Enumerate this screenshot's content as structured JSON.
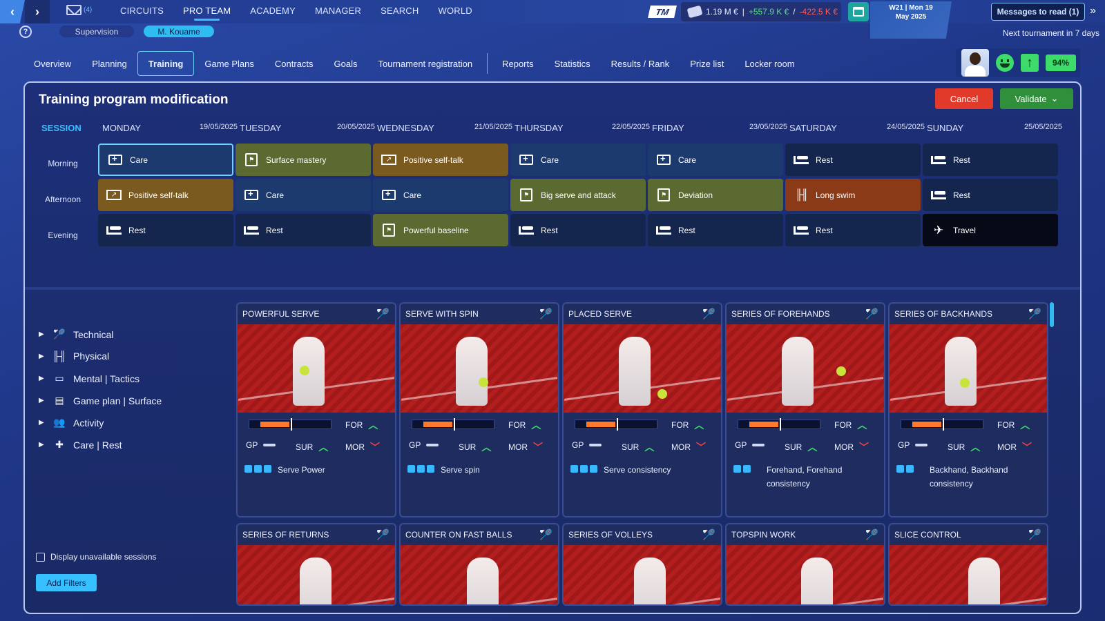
{
  "topbar": {
    "mail_count": "(4)",
    "nav": [
      "CIRCUITS",
      "PRO TEAM",
      "ACADEMY",
      "MANAGER",
      "SEARCH",
      "WORLD"
    ],
    "logo": "TM",
    "balance": "1.19 M €",
    "income": "+557.9 K €",
    "slash": "/",
    "expense": "-422.5 K €",
    "date_line1": "W21 | Mon 19",
    "date_line2": "May 2025",
    "messages": "Messages to read (1)"
  },
  "subheader": {
    "supervision": "Supervision",
    "player": "M. Kouame",
    "next_tournament": "Next tournament in 7 days"
  },
  "subnav": [
    "Overview",
    "Planning",
    "Training",
    "Game Plans",
    "Contracts",
    "Goals",
    "Tournament registration",
    "Reports",
    "Statistics",
    "Results / Rank",
    "Prize list",
    "Locker room"
  ],
  "player_status": {
    "percent": "94%"
  },
  "panel": {
    "title": "Training program modification",
    "cancel": "Cancel",
    "validate": "Validate",
    "session_label": "SESSION",
    "times": [
      "Morning",
      "Afternoon",
      "Evening"
    ],
    "days": [
      {
        "name": "MONDAY",
        "date": "19/05/2025"
      },
      {
        "name": "TUESDAY",
        "date": "20/05/2025"
      },
      {
        "name": "WEDNESDAY",
        "date": "21/05/2025"
      },
      {
        "name": "THURSDAY",
        "date": "22/05/2025"
      },
      {
        "name": "FRIDAY",
        "date": "23/05/2025"
      },
      {
        "name": "SATURDAY",
        "date": "24/05/2025"
      },
      {
        "name": "SUNDAY",
        "date": "25/05/2025"
      }
    ],
    "schedule": [
      [
        {
          "label": "Care",
          "type": "care"
        },
        {
          "label": "Surface mastery",
          "type": "gameplan"
        },
        {
          "label": "Positive self-talk",
          "type": "mental"
        },
        {
          "label": "Care",
          "type": "care"
        },
        {
          "label": "Care",
          "type": "care"
        },
        {
          "label": "Rest",
          "type": "rest"
        },
        {
          "label": "Rest",
          "type": "rest"
        }
      ],
      [
        {
          "label": "Positive self-talk",
          "type": "mental"
        },
        {
          "label": "Care",
          "type": "care"
        },
        {
          "label": "Care",
          "type": "care"
        },
        {
          "label": "Big serve and attack",
          "type": "gameplan"
        },
        {
          "label": "Deviation",
          "type": "gameplan"
        },
        {
          "label": "Long swim",
          "type": "physical"
        },
        {
          "label": "Rest",
          "type": "rest"
        }
      ],
      [
        {
          "label": "Rest",
          "type": "rest"
        },
        {
          "label": "Rest",
          "type": "rest"
        },
        {
          "label": "Powerful baseline",
          "type": "gameplan"
        },
        {
          "label": "Rest",
          "type": "rest"
        },
        {
          "label": "Rest",
          "type": "rest"
        },
        {
          "label": "Rest",
          "type": "rest"
        },
        {
          "label": "Travel",
          "type": "travel"
        }
      ]
    ]
  },
  "categories": [
    "Technical",
    "Physical",
    "Mental | Tactics",
    "Game plan | Surface",
    "Activity",
    "Care | Rest"
  ],
  "filters": {
    "unavailable": "Display unavailable sessions",
    "add": "Add Filters"
  },
  "stat_labels": {
    "for": "FOR",
    "gp": "GP",
    "sur": "SUR",
    "mor": "MOR"
  },
  "cards": [
    {
      "title": "POWERFUL SERVE",
      "dots": 3,
      "skill": "Serve Power"
    },
    {
      "title": "SERVE WITH SPIN",
      "dots": 3,
      "skill": "Serve spin"
    },
    {
      "title": "PLACED SERVE",
      "dots": 3,
      "skill": "Serve consistency"
    },
    {
      "title": "SERIES OF FOREHANDS",
      "dots": 2,
      "skill": "Forehand, Forehand consistency"
    },
    {
      "title": "SERIES OF BACKHANDS",
      "dots": 2,
      "skill": "Backhand, Backhand consistency"
    }
  ],
  "cards_row2": [
    "SERIES OF RETURNS",
    "COUNTER ON FAST BALLS",
    "SERIES OF VOLLEYS",
    "TOPSPIN WORK",
    "SLICE CONTROL"
  ],
  "colors": {
    "accent": "#37c0ff",
    "cancel": "#e23a2a",
    "validate": "#2f8f3a",
    "mood": "#3ddc6a"
  }
}
